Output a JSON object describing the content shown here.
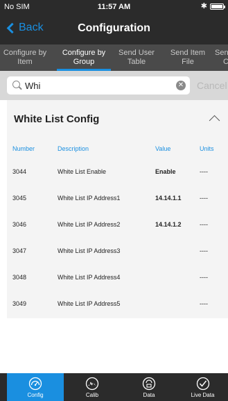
{
  "status_bar": {
    "carrier": "No SIM",
    "time": "11:57 AM"
  },
  "nav": {
    "back_label": "Back",
    "title": "Configuration"
  },
  "tabs": [
    {
      "line1": "Configure by",
      "line2": "Item"
    },
    {
      "line1": "Configure by",
      "line2": "Group"
    },
    {
      "line1": "Send User",
      "line2": "Table"
    },
    {
      "line1": "Send Item",
      "line2": "File"
    },
    {
      "line1": "Sen",
      "line2": "C"
    }
  ],
  "active_tab_index": 1,
  "search": {
    "value": "Whi",
    "cancel_label": "Cancel"
  },
  "section": {
    "title": "White List Config"
  },
  "table": {
    "headers": {
      "number": "Number",
      "description": "Description",
      "value": "Value",
      "units": "Units"
    },
    "rows": [
      {
        "number": "3044",
        "description": "White List Enable",
        "value": "Enable",
        "units": "----"
      },
      {
        "number": "3045",
        "description": "White List IP Address1",
        "value": "14.14.1.1",
        "units": "----"
      },
      {
        "number": "3046",
        "description": "White List IP Address2",
        "value": "14.14.1.2",
        "units": "----"
      },
      {
        "number": "3047",
        "description": "White List IP Address3",
        "value": "",
        "units": "----"
      },
      {
        "number": "3048",
        "description": "White List IP Address4",
        "value": "",
        "units": "----"
      },
      {
        "number": "3049",
        "description": "White List IP Address5",
        "value": "",
        "units": "----"
      }
    ]
  },
  "bottom_tabs": [
    {
      "label": "Config",
      "icon": "gauge-config-icon"
    },
    {
      "label": "Calib",
      "icon": "gauge-calib-icon"
    },
    {
      "label": "Data",
      "icon": "data-icon"
    },
    {
      "label": "Live Data",
      "icon": "live-data-check-icon"
    }
  ],
  "active_bottom_tab_index": 0,
  "colors": {
    "accent": "#1a8fe0",
    "bar": "#2b2b2b",
    "tabs_bg": "#4a4a4a"
  }
}
